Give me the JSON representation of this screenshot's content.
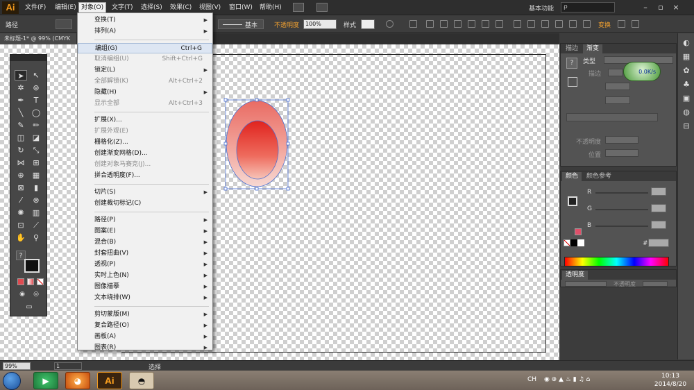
{
  "app": {
    "logo": "Ai"
  },
  "menubar": {
    "items": [
      "文件(F)",
      "编辑(E)",
      "对象(O)",
      "文字(T)",
      "选择(S)",
      "效果(C)",
      "视图(V)",
      "窗口(W)",
      "帮助(H)"
    ],
    "workspace": "基本功能",
    "search_placeholder": "ρ",
    "window_buttons": [
      "–",
      "▫",
      "×"
    ]
  },
  "controlbar": {
    "path_label": "路径",
    "stroke_style": "基本",
    "opacity_label": "不透明度",
    "opacity_value": "100%",
    "style_label": "样式",
    "transform_label": "变换"
  },
  "document": {
    "tab_title": "未标题-1* @ 99% (CMYK"
  },
  "object_menu": {
    "items": [
      {
        "label": "变换(T)",
        "shortcut": "",
        "submenu": true,
        "disabled": false
      },
      {
        "label": "排列(A)",
        "shortcut": "",
        "submenu": true,
        "disabled": false
      },
      {
        "sep": true
      },
      {
        "label": "编组(G)",
        "shortcut": "Ctrl+G",
        "submenu": false,
        "disabled": false,
        "highlight": true
      },
      {
        "label": "取消编组(U)",
        "shortcut": "Shift+Ctrl+G",
        "submenu": false,
        "disabled": true
      },
      {
        "label": "锁定(L)",
        "shortcut": "",
        "submenu": true,
        "disabled": false
      },
      {
        "label": "全部解锁(K)",
        "shortcut": "Alt+Ctrl+2",
        "submenu": false,
        "disabled": true
      },
      {
        "label": "隐藏(H)",
        "shortcut": "",
        "submenu": true,
        "disabled": false
      },
      {
        "label": "显示全部",
        "shortcut": "Alt+Ctrl+3",
        "submenu": false,
        "disabled": true
      },
      {
        "sep": true
      },
      {
        "label": "扩展(X)...",
        "shortcut": "",
        "submenu": false,
        "disabled": false
      },
      {
        "label": "扩展外观(E)",
        "shortcut": "",
        "submenu": false,
        "disabled": true
      },
      {
        "label": "栅格化(Z)...",
        "shortcut": "",
        "submenu": false,
        "disabled": false
      },
      {
        "label": "创建渐变网格(D)...",
        "shortcut": "",
        "submenu": false,
        "disabled": false
      },
      {
        "label": "创建对象马赛克(J)...",
        "shortcut": "",
        "submenu": false,
        "disabled": true
      },
      {
        "label": "拼合透明度(F)...",
        "shortcut": "",
        "submenu": false,
        "disabled": false
      },
      {
        "sep": true
      },
      {
        "label": "切片(S)",
        "shortcut": "",
        "submenu": true,
        "disabled": false
      },
      {
        "label": "创建裁切标记(C)",
        "shortcut": "",
        "submenu": false,
        "disabled": false
      },
      {
        "sep": true
      },
      {
        "label": "路径(P)",
        "shortcut": "",
        "submenu": true,
        "disabled": false
      },
      {
        "label": "图案(E)",
        "shortcut": "",
        "submenu": true,
        "disabled": false
      },
      {
        "label": "混合(B)",
        "shortcut": "",
        "submenu": true,
        "disabled": false
      },
      {
        "label": "封套扭曲(V)",
        "shortcut": "",
        "submenu": true,
        "disabled": false
      },
      {
        "label": "透视(P)",
        "shortcut": "",
        "submenu": true,
        "disabled": false
      },
      {
        "label": "实时上色(N)",
        "shortcut": "",
        "submenu": true,
        "disabled": false
      },
      {
        "label": "图像描摹",
        "shortcut": "",
        "submenu": true,
        "disabled": false
      },
      {
        "label": "文本绕排(W)",
        "shortcut": "",
        "submenu": true,
        "disabled": false
      },
      {
        "sep": true
      },
      {
        "label": "剪切蒙版(M)",
        "shortcut": "",
        "submenu": true,
        "disabled": false
      },
      {
        "label": "复合路径(O)",
        "shortcut": "",
        "submenu": true,
        "disabled": false
      },
      {
        "label": "画板(A)",
        "shortcut": "",
        "submenu": true,
        "disabled": false
      },
      {
        "label": "图表(R)",
        "shortcut": "",
        "submenu": true,
        "disabled": false
      }
    ]
  },
  "gradient_panel": {
    "tabs": [
      "描边",
      "渐变"
    ],
    "type_label": "类型",
    "angle_label": "描边",
    "opacity_label": "不透明度",
    "position_label": "位置",
    "badge_text": "0.0K/s"
  },
  "color_panel": {
    "tabs": [
      "颜色",
      "颜色参考"
    ],
    "channels": [
      "R",
      "G",
      "B"
    ],
    "hex_label": "#"
  },
  "transparency_panel": {
    "tabs": [
      "透明度"
    ],
    "mode_label": "不透明度"
  },
  "statusbar": {
    "zoom": "99%",
    "page": "1",
    "mode": "选择"
  },
  "taskbar": {
    "apps": [
      "Ai"
    ],
    "tray_lang": "CH",
    "time": "10:13",
    "date": "2014/8/20"
  },
  "colors": {
    "accent": "#f39a1e",
    "ellipse_outer_top": "#e8877f",
    "ellipse_inner": "#e3302a",
    "selection": "#4a6fd1"
  }
}
